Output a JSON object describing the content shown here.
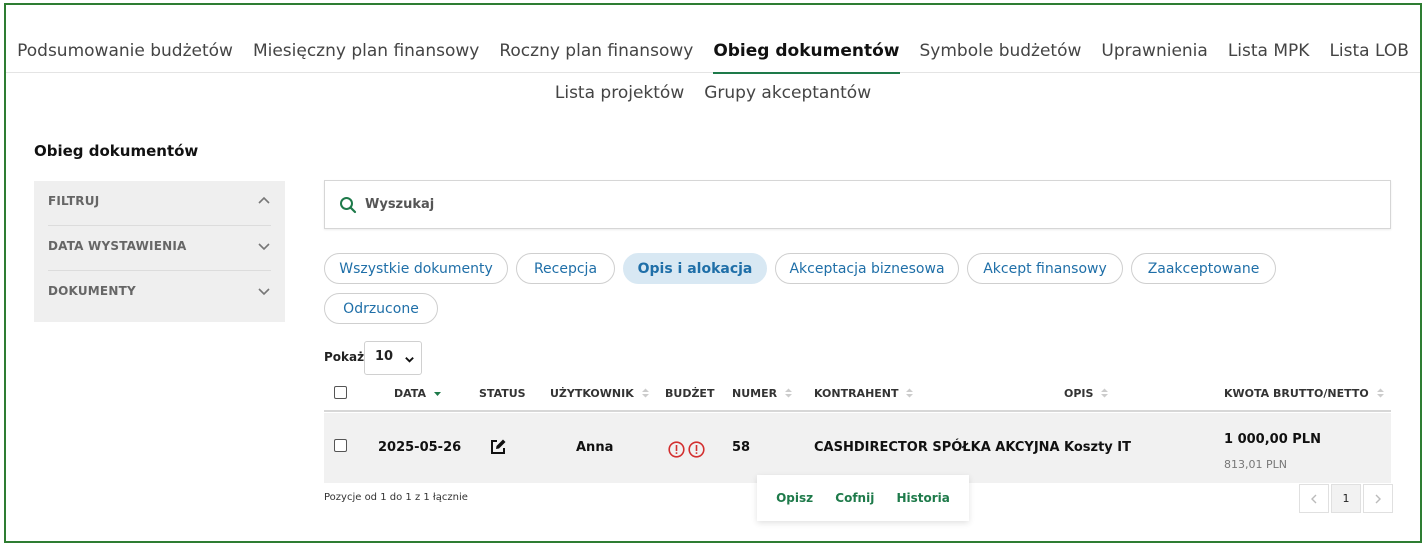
{
  "nav": {
    "top_items": [
      "Podsumowanie budżetów",
      "Miesięczny plan finansowy",
      "Roczny plan finansowy",
      "Obieg dokumentów",
      "Symbole budżetów",
      "Uprawnienia",
      "Lista MPK",
      "Lista LOB"
    ],
    "active_index": 3,
    "sub_items": [
      "Lista projektów",
      "Grupy akceptantów"
    ]
  },
  "page": {
    "title": "Obieg dokumentów"
  },
  "filters": {
    "title": "FILTRUJ",
    "items": [
      "DATA WYSTAWIENIA",
      "DOKUMENTY"
    ]
  },
  "search": {
    "placeholder": "Wyszukaj"
  },
  "status_tabs": {
    "items": [
      "Wszystkie dokumenty",
      "Recepcja",
      "Opis i alokacja",
      "Akceptacja biznesowa",
      "Akcept finansowy",
      "Zaakceptowane",
      "Odrzucone"
    ],
    "active": "Opis i alokacja"
  },
  "page_size": {
    "label": "Pokaż",
    "value": "10"
  },
  "table": {
    "columns": [
      "DATA",
      "STATUS",
      "UŻYTKOWNIK",
      "BUDŻET",
      "NUMER",
      "KONTRAHENT",
      "OPIS",
      "KWOTA BRUTTO/NETTO"
    ],
    "rows": [
      {
        "date": "2025-05-26",
        "status_icon": "edit-icon",
        "user": "Anna",
        "budget_icons": [
          "alert-circle-icon",
          "alert-circle-icon"
        ],
        "number": "58",
        "contractor": "CASHDIRECTOR SPÓŁKA AKCYJNA",
        "description": "Koszty IT",
        "gross": "1 000,00  PLN",
        "net": "813,01 PLN"
      }
    ]
  },
  "footer": {
    "info": "Pozycje od 1 do 1 z 1 łącznie"
  },
  "row_actions": {
    "describe": "Opisz",
    "undo": "Cofnij",
    "history": "Historia"
  },
  "pagination": {
    "current_page": "1"
  },
  "colors": {
    "accent_green": "#1e7a4a",
    "frame_green": "#2e7d32",
    "link_blue": "#1f6fa8",
    "active_pill_bg": "#d8e8f3",
    "alert_red": "#d32f2f"
  }
}
